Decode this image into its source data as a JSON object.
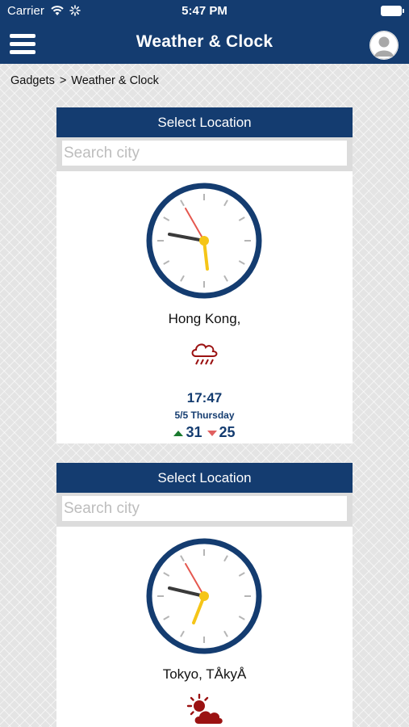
{
  "status_bar": {
    "carrier": "Carrier",
    "time": "5:47 PM"
  },
  "header": {
    "title": "Weather & Clock",
    "menu_icon": "hamburger-menu-icon",
    "avatar_icon": "user-avatar-icon"
  },
  "breadcrumb": {
    "root": "Gadgets",
    "separator": ">",
    "current": "Weather & Clock"
  },
  "colors": {
    "primary": "#143c70",
    "weather_icon": "#9b1212",
    "temp_high": "#1a7a2e",
    "temp_low": "#e06060",
    "second_hand": "#e5584f",
    "hour_hand": "#f5c518",
    "minute_hand": "#3a3a3a"
  },
  "widgets": [
    {
      "select_label": "Select Location",
      "search_placeholder": "Search city",
      "search_value": "",
      "city": "Hong Kong,",
      "weather_icon": "rain-cloud-icon",
      "time": "17:47",
      "date": "5/5 Thursday",
      "temp_high": "31",
      "temp_low": "25"
    },
    {
      "select_label": "Select Location",
      "search_placeholder": "Search city",
      "search_value": "",
      "city": "Tokyo, TÅkyÅ",
      "weather_icon": "partly-cloudy-sun-icon"
    }
  ]
}
